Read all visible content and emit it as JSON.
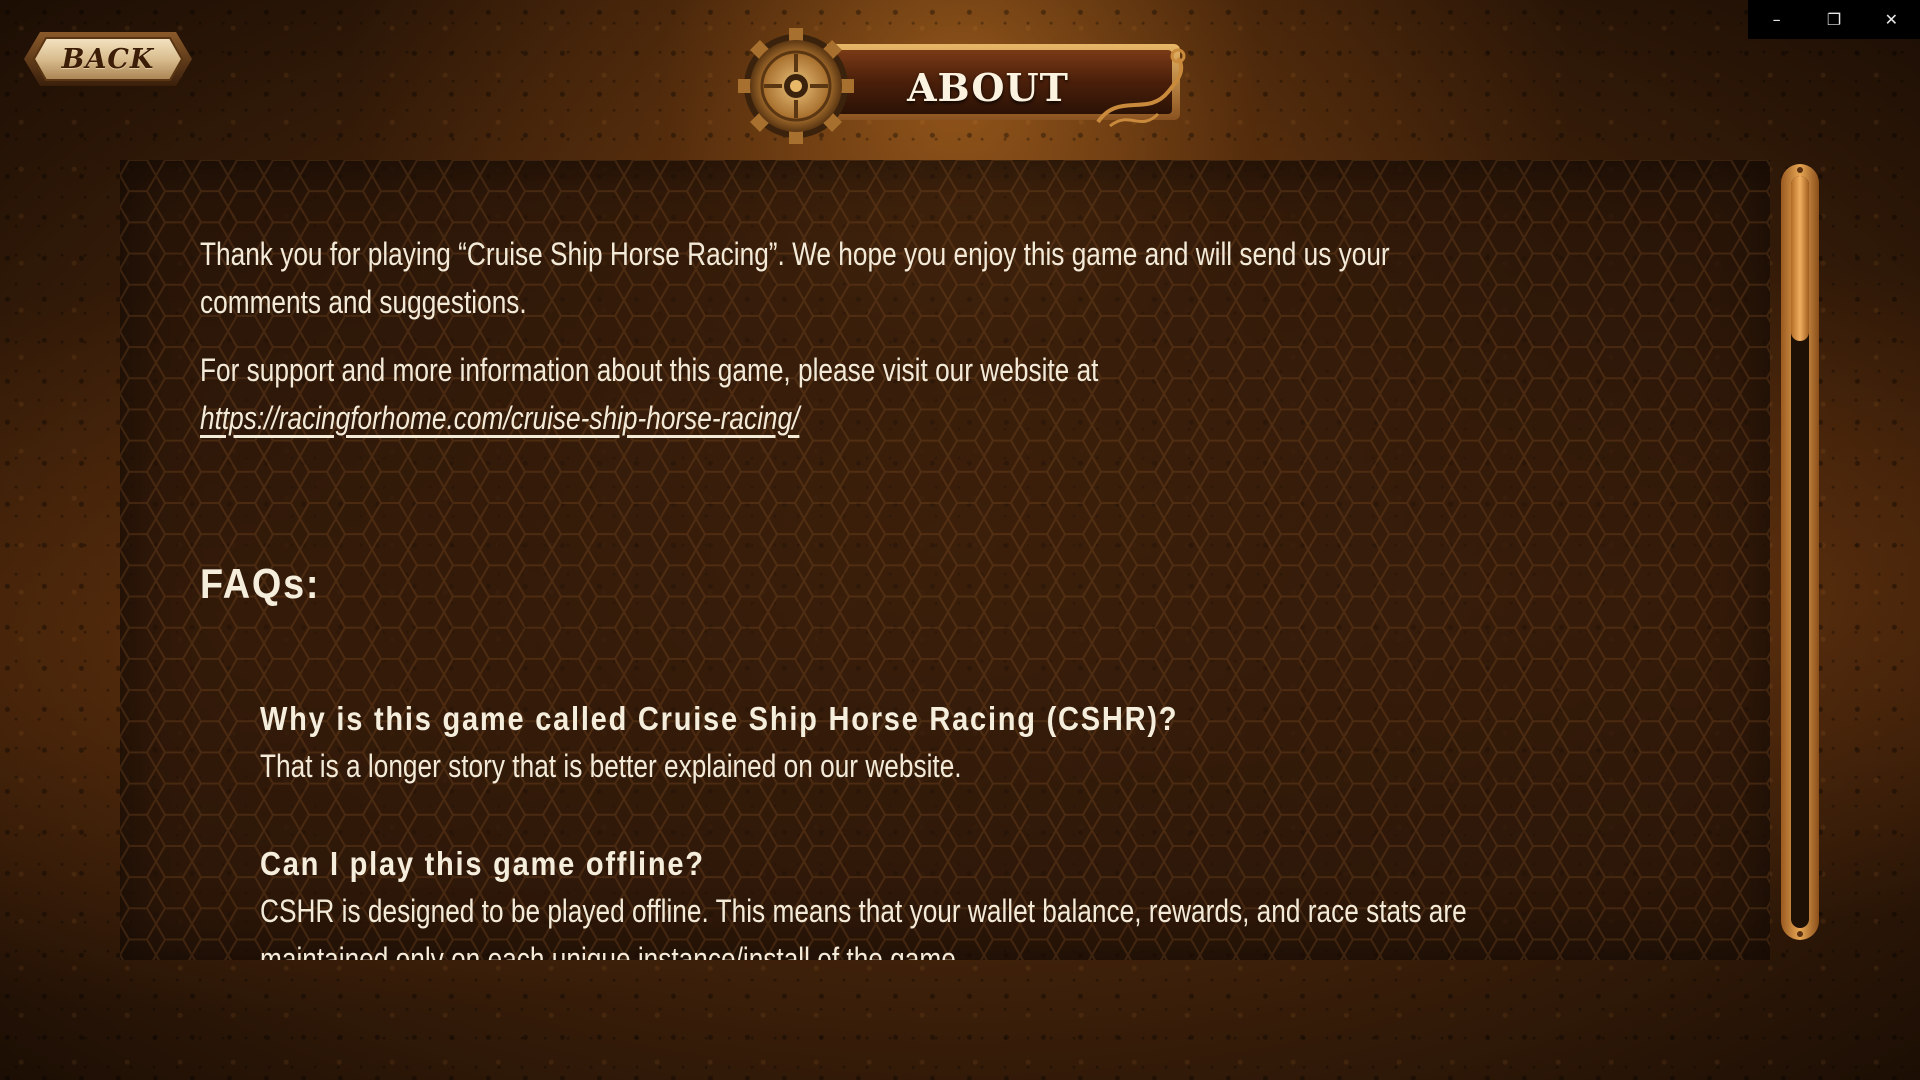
{
  "window": {
    "minimize_icon": "minimize-icon",
    "restore_icon": "restore-icon",
    "close_icon": "close-icon",
    "minimize_glyph": "–",
    "restore_glyph": "❐",
    "close_glyph": "✕"
  },
  "nav": {
    "back_label": "BACK"
  },
  "header": {
    "title": "ABOUT",
    "gear_icon": "gear-icon"
  },
  "content": {
    "intro": "Thank you for playing “Cruise Ship Horse Racing”. We hope you enjoy this game and will send us your comments and suggestions.",
    "support_text": "For support and more information about this game, please visit our website at",
    "website_link": "https://racingforhome.com/cruise-ship-horse-racing/",
    "faq_heading": "FAQs:",
    "faqs": [
      {
        "question": "Why is this game called Cruise Ship Horse Racing (CSHR)?",
        "answer": "That is a longer story that is better explained on our website."
      },
      {
        "question": "Can I play this game offline?",
        "answer": "CSHR is designed to be played offline. This means that your wallet balance, rewards, and race stats are maintained only on each unique instance/install of the game."
      }
    ]
  },
  "scrollbar": {
    "thumb_fraction": 0.22,
    "scroll_position": 0.0
  },
  "colors": {
    "text": "#f3ead8",
    "accent_copper": "#c77a2e",
    "panel": "#26140a"
  }
}
